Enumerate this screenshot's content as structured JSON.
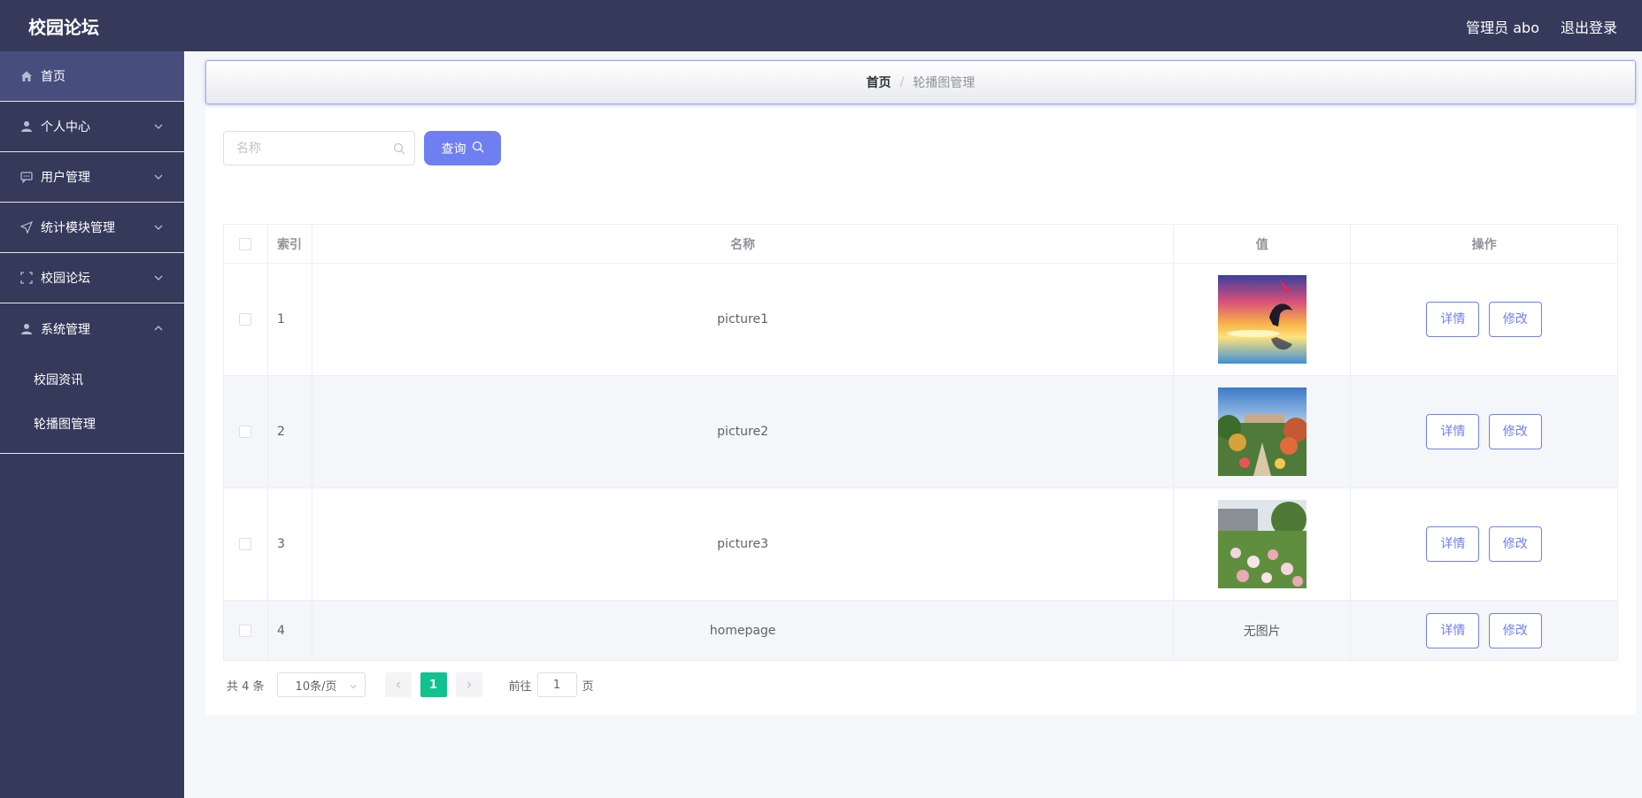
{
  "header": {
    "brand": "校园论坛",
    "admin_label": "管理员 abo",
    "logout_label": "退出登录"
  },
  "sidebar": {
    "items": [
      {
        "label": "首页",
        "icon": "home-icon"
      },
      {
        "label": "个人中心",
        "icon": "user-icon"
      },
      {
        "label": "用户管理",
        "icon": "chat-icon"
      },
      {
        "label": "统计模块管理",
        "icon": "send-icon"
      },
      {
        "label": "校园论坛",
        "icon": "fullscreen-icon"
      },
      {
        "label": "系统管理",
        "icon": "user-icon"
      }
    ],
    "sub_items": [
      "校园资讯",
      "轮播图管理"
    ]
  },
  "breadcrumb": {
    "home": "首页",
    "separator": "/",
    "current": "轮播图管理"
  },
  "search": {
    "placeholder": "名称",
    "button_label": "查询"
  },
  "table": {
    "columns": [
      "索引",
      "名称",
      "值",
      "操作"
    ],
    "rows": [
      {
        "index": "1",
        "name": "picture1",
        "value": "",
        "image": "sunset-dolphin"
      },
      {
        "index": "2",
        "name": "picture2",
        "value": "",
        "image": "campus-garden"
      },
      {
        "index": "3",
        "name": "picture3",
        "value": "",
        "image": "flower-field"
      },
      {
        "index": "4",
        "name": "homepage",
        "value": "无图片",
        "image": ""
      }
    ],
    "detail_label": "详情",
    "edit_label": "修改"
  },
  "pagination": {
    "total": "共 4 条",
    "page_size": "10条/页",
    "current_page": "1",
    "goto_label": "前往",
    "goto_value": "1",
    "goto_suffix": "页"
  },
  "colors": {
    "header_bg": "#35395a",
    "accent": "#6f7ff2",
    "page_active": "#10c28e"
  }
}
